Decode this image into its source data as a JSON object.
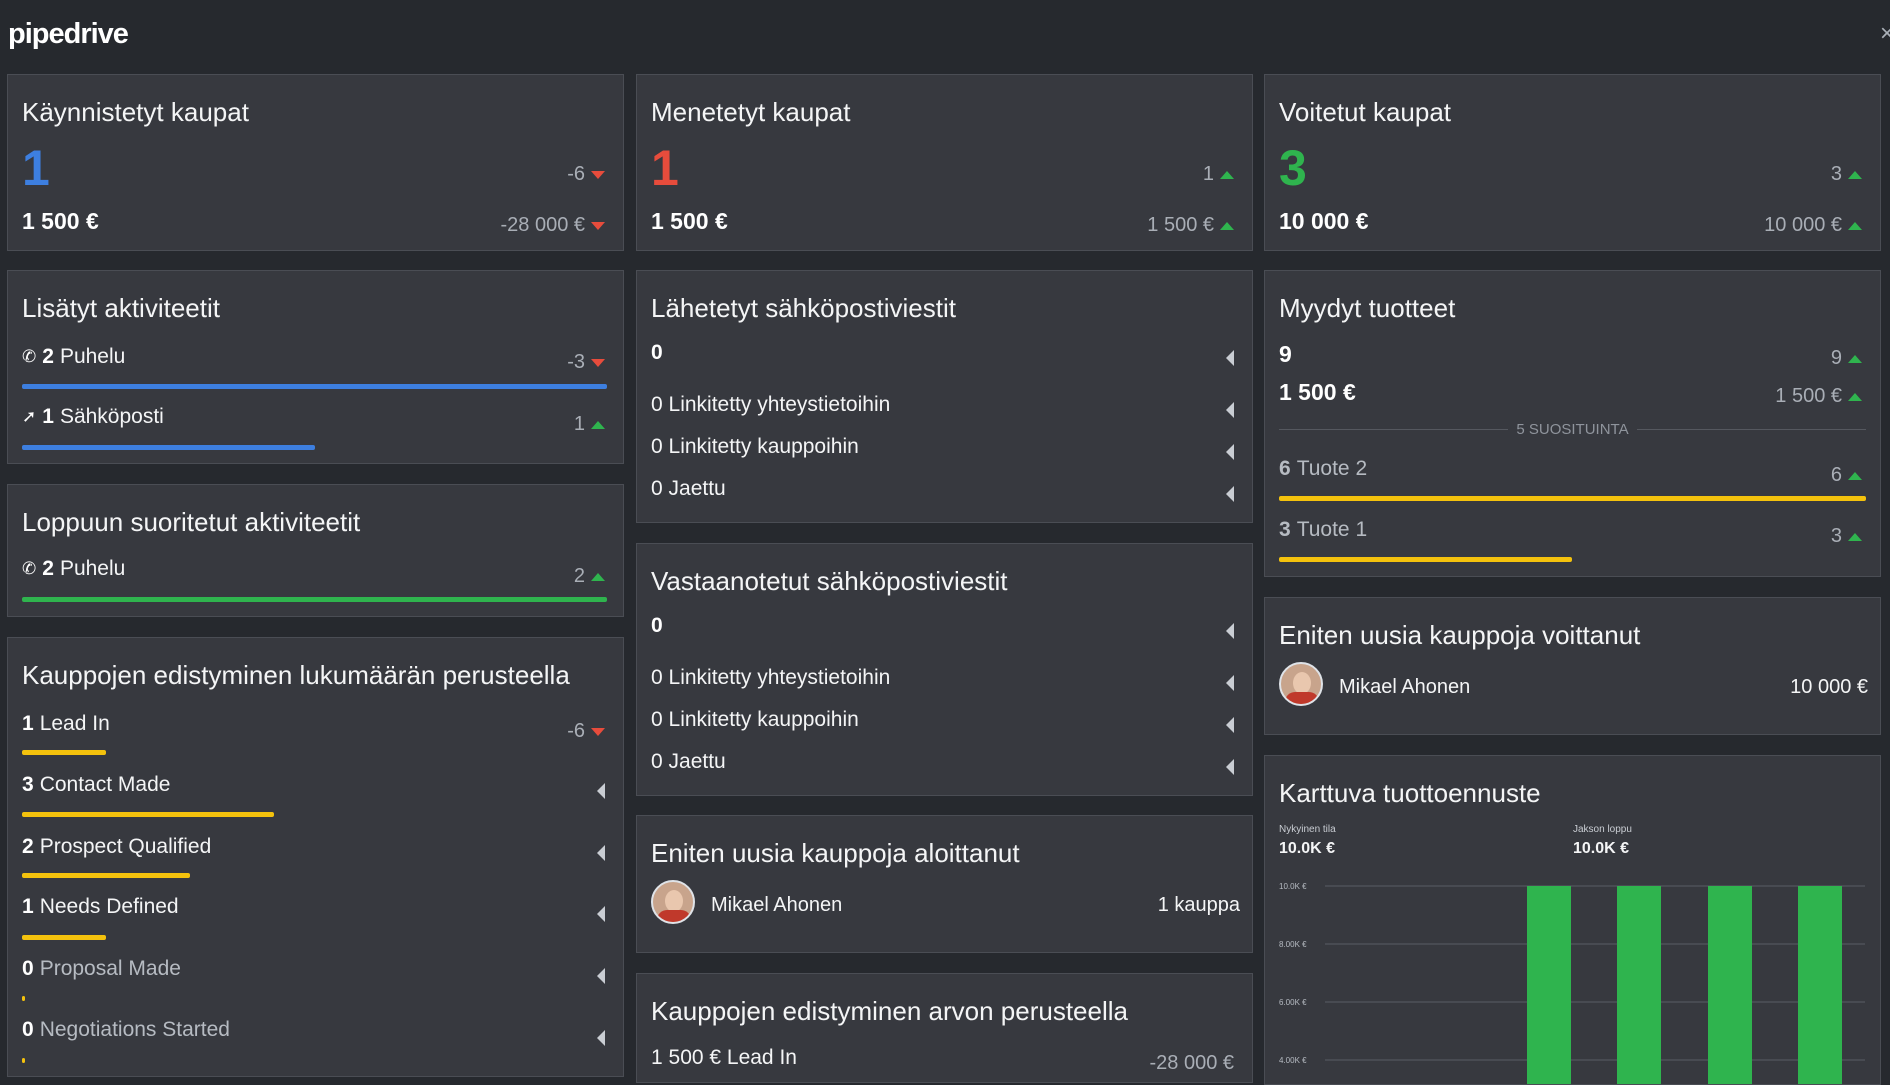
{
  "app": {
    "logo": "pipedrive",
    "close_symbol": "×"
  },
  "colors": {
    "background": "#26292e",
    "card": "#37393f",
    "blue": "#3d7fe0",
    "red": "#e74c3c",
    "green": "#2fb44e",
    "yellow": "#f4c20d"
  },
  "started_deals": {
    "title": "Käynnistetyt kaupat",
    "count": "1",
    "amount": "1 500 €",
    "count_delta": "-6",
    "amount_delta": "-28 000 €"
  },
  "lost_deals": {
    "title": "Menetetyt kaupat",
    "count": "1",
    "amount": "1 500 €",
    "count_delta": "1",
    "amount_delta": "1 500 €"
  },
  "won_deals": {
    "title": "Voitetut kaupat",
    "count": "3",
    "amount": "10 000 €",
    "count_delta": "3",
    "amount_delta": "10 000 €"
  },
  "added_activities": {
    "title": "Lisätyt aktiviteetit",
    "items": [
      {
        "icon": "phone-icon",
        "num": "2",
        "label": "Puhelu",
        "delta": "-3",
        "bar_fraction": 1.0
      },
      {
        "icon": "send-icon",
        "num": "1",
        "label": "Sähköposti",
        "delta": "1",
        "bar_fraction": 0.5
      }
    ]
  },
  "completed_activities": {
    "title": "Loppuun suoritetut aktiviteetit",
    "items": [
      {
        "icon": "phone-icon",
        "num": "2",
        "label": "Puhelu",
        "delta": "2",
        "bar_fraction": 1.0
      }
    ]
  },
  "deal_progress_count": {
    "title": "Kauppojen edistyminen lukumäärän perusteella",
    "first_delta": "-6",
    "stages": [
      {
        "num": "1",
        "label": "Lead In",
        "bar_fraction": 0.33
      },
      {
        "num": "3",
        "label": "Contact Made",
        "bar_fraction": 1.0
      },
      {
        "num": "2",
        "label": "Prospect Qualified",
        "bar_fraction": 0.67
      },
      {
        "num": "1",
        "label": "Needs Defined",
        "bar_fraction": 0.33
      },
      {
        "num": "0",
        "label": "Proposal Made",
        "bar_fraction": 0.0
      },
      {
        "num": "0",
        "label": "Negotiations Started",
        "bar_fraction": 0.0
      }
    ]
  },
  "sent_emails": {
    "title": "Lähetetyt sähköpostiviestit",
    "total": "0",
    "rows": [
      "0 Linkitetty yhteystietoihin",
      "0 Linkitetty kauppoihin",
      "0 Jaettu"
    ]
  },
  "received_emails": {
    "title": "Vastaanotetut sähköpostiviestit",
    "total": "0",
    "rows": [
      "0 Linkitetty yhteystietoihin",
      "0 Linkitetty kauppoihin",
      "0 Jaettu"
    ]
  },
  "most_deals_started": {
    "title": "Eniten uusia kauppoja aloittanut",
    "name": "Mikael Ahonen",
    "value": "1 kauppa"
  },
  "deal_progress_value": {
    "title": "Kauppojen edistyminen arvon perusteella",
    "first_row": "1 500 € Lead In",
    "first_delta": "-28 000 €"
  },
  "sold_products": {
    "title": "Myydyt tuotteet",
    "count": "9",
    "count_delta": "9",
    "amount": "1 500 €",
    "amount_delta": "1 500 €",
    "suggestions_label": "5 SUOSITUINTA",
    "products": [
      {
        "num": "6",
        "label": "Tuote 2",
        "delta": "6",
        "bar_fraction": 1.0
      },
      {
        "num": "3",
        "label": "Tuote 1",
        "delta": "3",
        "bar_fraction": 0.5
      }
    ]
  },
  "most_deals_won": {
    "title": "Eniten uusia kauppoja voittanut",
    "name": "Mikael Ahonen",
    "value": "10 000 €"
  },
  "revenue_forecast": {
    "title": "Karttuva tuottoennuste",
    "current_label": "Nykyinen tila",
    "current_value": "10.0K €",
    "end_label": "Jakson loppu",
    "end_value": "10.0K €"
  },
  "chart_data": {
    "type": "bar",
    "title": "Karttuva tuottoennuste",
    "y_tick_labels": [
      "10.0K €",
      "8.00K €",
      "6.00K €",
      "4.00K €"
    ],
    "ylim": [
      0,
      10000
    ],
    "series": [
      {
        "values": [
          10000,
          10000,
          10000,
          10000
        ]
      }
    ],
    "color": "#2fb44e",
    "grid": true
  }
}
